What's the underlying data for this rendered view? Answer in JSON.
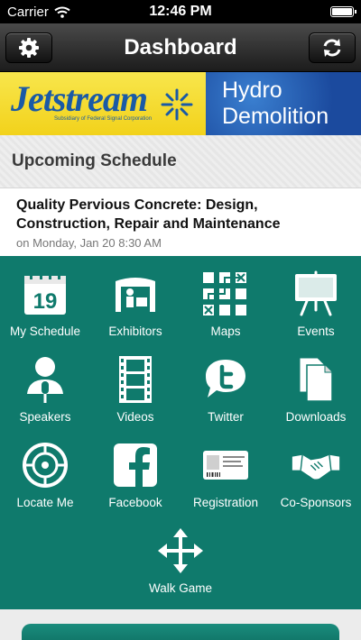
{
  "status": {
    "carrier": "Carrier",
    "time": "12:46 PM"
  },
  "nav": {
    "title": "Dashboard",
    "left_icon": "gear-icon",
    "right_icon": "refresh-icon"
  },
  "banner": {
    "left_logo": "Jetstream",
    "left_sub": "Subsidiary of Federal Signal Corporation",
    "right_line1": "Hydro",
    "right_line2": "Demolition"
  },
  "schedule": {
    "header": "Upcoming Schedule",
    "item": {
      "title": "Quality Pervious Concrete: Design, Construction, Repair and Maintenance",
      "date": "on Monday, Jan 20 8:30 AM"
    }
  },
  "calendar_day": "19",
  "tiles": [
    {
      "label": "My Schedule",
      "icon": "calendar-icon"
    },
    {
      "label": "Exhibitors",
      "icon": "booth-icon"
    },
    {
      "label": "Maps",
      "icon": "map-icon"
    },
    {
      "label": "Events",
      "icon": "easel-icon"
    },
    {
      "label": "Speakers",
      "icon": "speaker-icon"
    },
    {
      "label": "Videos",
      "icon": "film-icon"
    },
    {
      "label": "Twitter",
      "icon": "twitter-icon"
    },
    {
      "label": "Downloads",
      "icon": "documents-icon"
    },
    {
      "label": "Locate Me",
      "icon": "target-icon"
    },
    {
      "label": "Facebook",
      "icon": "facebook-icon"
    },
    {
      "label": "Registration",
      "icon": "id-card-icon"
    },
    {
      "label": "Co-Sponsors",
      "icon": "handshake-icon"
    },
    {
      "label": "Walk Game",
      "icon": "move-arrows-icon"
    }
  ],
  "colors": {
    "grid_bg": "#0f7a6c",
    "nav_bg": "#1c1c1c",
    "jetstream_yellow": "#f2d21b",
    "hydro_blue": "#1b4a9e"
  }
}
